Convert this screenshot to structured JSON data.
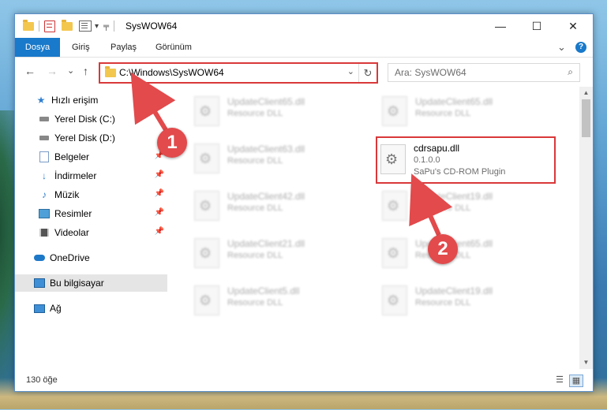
{
  "titlebar": {
    "title": "SysWOW64",
    "qa_dropdown": "▾",
    "minimize": "—",
    "maximize": "☐",
    "close": "✕"
  },
  "ribbon": {
    "tabs": [
      {
        "label": "Dosya"
      },
      {
        "label": "Giriş"
      },
      {
        "label": "Paylaş"
      },
      {
        "label": "Görünüm"
      }
    ],
    "expand": "⌄",
    "help": "?"
  },
  "nav": {
    "back": "←",
    "forward": "→",
    "recent": "⌄",
    "up": "↑",
    "address": "C:\\Windows\\SysWOW64",
    "address_chevron": "⌄",
    "refresh": "↻",
    "search_placeholder": "Ara: SysWOW64",
    "search_icon": "⌕"
  },
  "sidebar": {
    "items": [
      {
        "label": "Hızlı erişim",
        "icon": "star-icon"
      },
      {
        "label": "Yerel Disk (C:)",
        "icon": "drive-icon"
      },
      {
        "label": "Yerel Disk (D:)",
        "icon": "drive-icon"
      },
      {
        "label": "Belgeler",
        "icon": "documents-icon"
      },
      {
        "label": "İndirmeler",
        "icon": "download-icon"
      },
      {
        "label": "Müzik",
        "icon": "music-icon"
      },
      {
        "label": "Resimler",
        "icon": "pictures-icon"
      },
      {
        "label": "Videolar",
        "icon": "videos-icon"
      },
      {
        "label": "OneDrive",
        "icon": "cloud-icon"
      },
      {
        "label": "Bu bilgisayar",
        "icon": "computer-icon"
      },
      {
        "label": "Ağ",
        "icon": "network-icon"
      }
    ]
  },
  "files": {
    "left": [
      {
        "name": "UpdateClient65.dll",
        "type": "Resource DLL"
      },
      {
        "name": "UpdateClient63.dll",
        "type": "Resource DLL"
      },
      {
        "name": "UpdateClient42.dll",
        "type": "Resource DLL"
      },
      {
        "name": "UpdateClient21.dll",
        "type": "Resource DLL"
      },
      {
        "name": "UpdateClient5.dll",
        "type": "Resource DLL"
      }
    ],
    "right": [
      {
        "name": "UpdateClient65.dll",
        "type": "Resource DLL"
      },
      {
        "name": "UpdateClient19.dll",
        "type": "Resource DLL"
      },
      {
        "name": "UpdateClient65.dll",
        "type": "Resource DLL"
      },
      {
        "name": "UpdateClient19.dll",
        "type": "Resource DLL"
      }
    ],
    "highlighted": {
      "name": "cdrsapu.dll",
      "version": "0.1.0.0",
      "description": "SaPu's CD-ROM Plugin"
    }
  },
  "status": {
    "count": "130 öğe"
  },
  "annotations": {
    "step1": "1",
    "step2": "2",
    "color": "#e24a4c"
  },
  "colors": {
    "accent": "#1979ca",
    "highlight_border": "#d9383a"
  }
}
